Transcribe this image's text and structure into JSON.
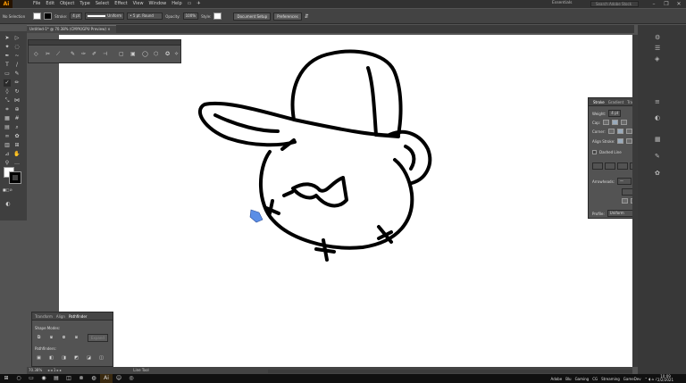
{
  "app": {
    "logo": "Ai",
    "workspace": "Essentials",
    "search_placeholder": "Search Adobe Stock"
  },
  "menu": [
    "File",
    "Edit",
    "Object",
    "Type",
    "Select",
    "Effect",
    "View",
    "Window",
    "Help"
  ],
  "control_bar": {
    "selection_label": "No Selection",
    "stroke_label": "Stroke:",
    "stroke_value": "4 pt",
    "uniform": "Uniform",
    "brush": "5 pt. Round",
    "opacity_label": "Opacity:",
    "opacity_value": "100%",
    "style_label": "Style:",
    "doc_setup": "Document Setup",
    "preferences": "Preferences"
  },
  "document_tab": "Untitled-1* @ 70.38% (CMYK/GPU Preview)",
  "stroke_panel": {
    "tabs": [
      "Stroke",
      "Gradient",
      "Transparenc"
    ],
    "weight_label": "Weight:",
    "weight_value": "4 pt",
    "cap_label": "Cap:",
    "corner_label": "Corner:",
    "align_label": "Align Stroke:",
    "dashed_label": "Dashed Line",
    "arrowheads_label": "Arrowheads:",
    "profile_label": "Profile:",
    "profile_value": "Uniform"
  },
  "pathfinder_panel": {
    "tabs": [
      "Transform",
      "Align",
      "Pathfinder"
    ],
    "shape_modes": "Shape Modes:",
    "pathfinders": "Pathfinders:",
    "expand": "Expand"
  },
  "status": {
    "zoom": "70.38%",
    "tool": "Line Tool"
  },
  "taskbar": {
    "items": [
      "Adobe",
      "Blu",
      "Gaming",
      "CG",
      "Streaming",
      "GameDev"
    ],
    "time": "10:09",
    "date": "2/2/2021"
  },
  "colors": {
    "accent": "#ff9a00",
    "canvas": "#ffffff",
    "ui_dark": "#535353",
    "pen_cursor": "#5b8ee6"
  }
}
